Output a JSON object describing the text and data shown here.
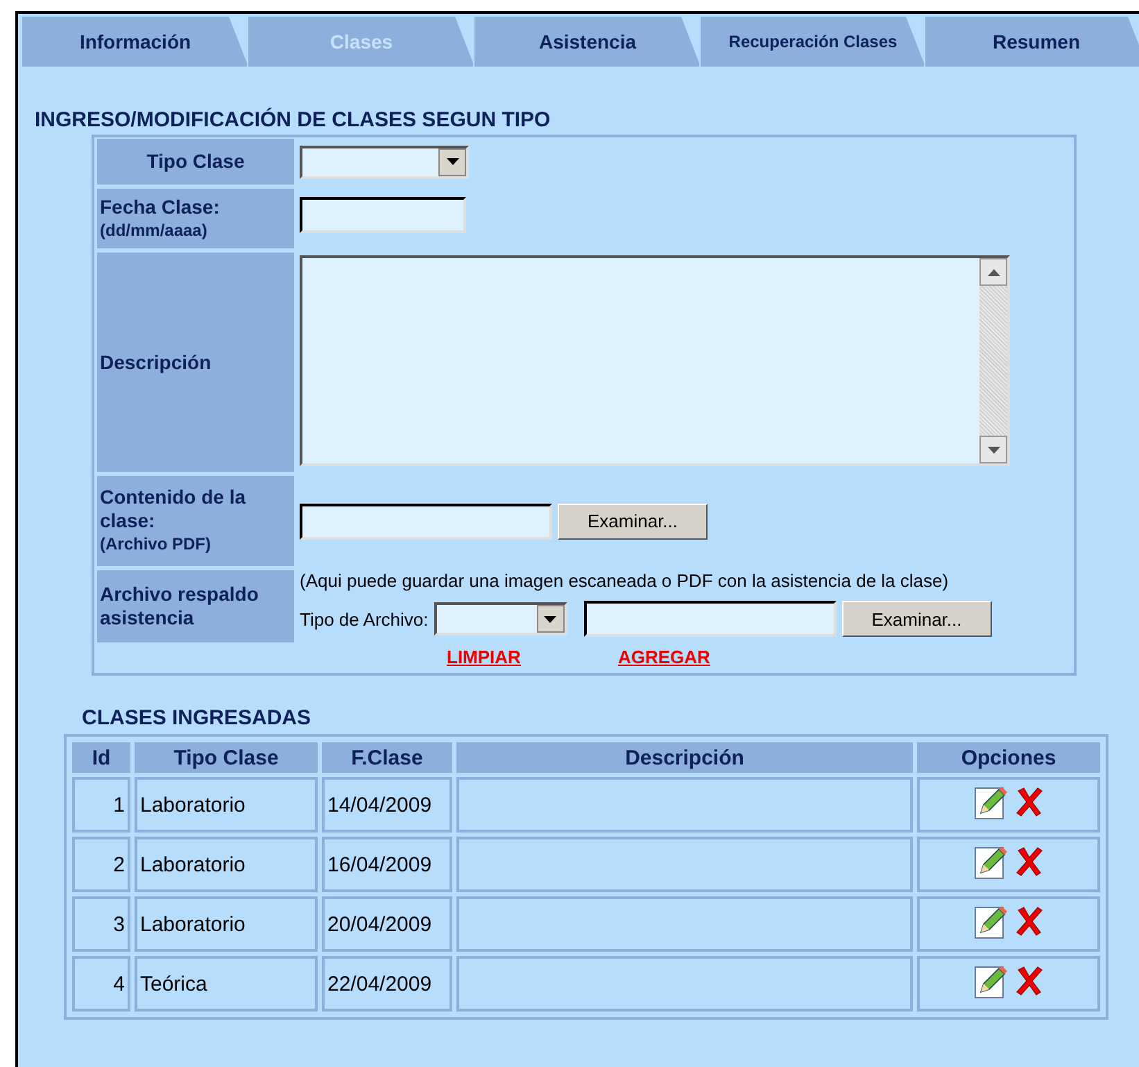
{
  "tabs": [
    {
      "label": "Información",
      "selected": false
    },
    {
      "label": "Clases",
      "selected": true
    },
    {
      "label": "Asistencia",
      "selected": false
    },
    {
      "label": "Recuperación Clases",
      "selected": false
    },
    {
      "label": "Resumen",
      "selected": false
    }
  ],
  "form": {
    "title": "INGRESO/MODIFICACIÓN DE CLASES SEGUN TIPO",
    "tipo_clase": {
      "label": "Tipo Clase"
    },
    "fecha_clase": {
      "label": "Fecha Clase:",
      "hint": "(dd/mm/aaaa)"
    },
    "descripcion": {
      "label": "Descripción"
    },
    "contenido": {
      "label": "Contenido de la clase:",
      "hint": "(Archivo PDF)",
      "button": "Examinar..."
    },
    "respaldo": {
      "label": "Archivo respaldo asistencia",
      "note": "(Aqui puede guardar una imagen escaneada o PDF con la asistencia de la clase)",
      "tipo_label": "Tipo de Archivo:",
      "button": "Examinar..."
    },
    "links": [
      "LIMPIAR",
      "AGREGAR"
    ]
  },
  "table": {
    "title": "CLASES INGRESADAS",
    "columns": [
      "Id",
      "Tipo Clase",
      "F.Clase",
      "Descripción",
      "Opciones"
    ],
    "rows": [
      {
        "id": "1",
        "tipo": "Laboratorio",
        "fecha": "14/04/2009"
      },
      {
        "id": "2",
        "tipo": "Laboratorio",
        "fecha": "16/04/2009"
      },
      {
        "id": "3",
        "tipo": "Laboratorio",
        "fecha": "20/04/2009"
      },
      {
        "id": "4",
        "tipo": "Teórica",
        "fecha": "22/04/2009"
      }
    ]
  }
}
